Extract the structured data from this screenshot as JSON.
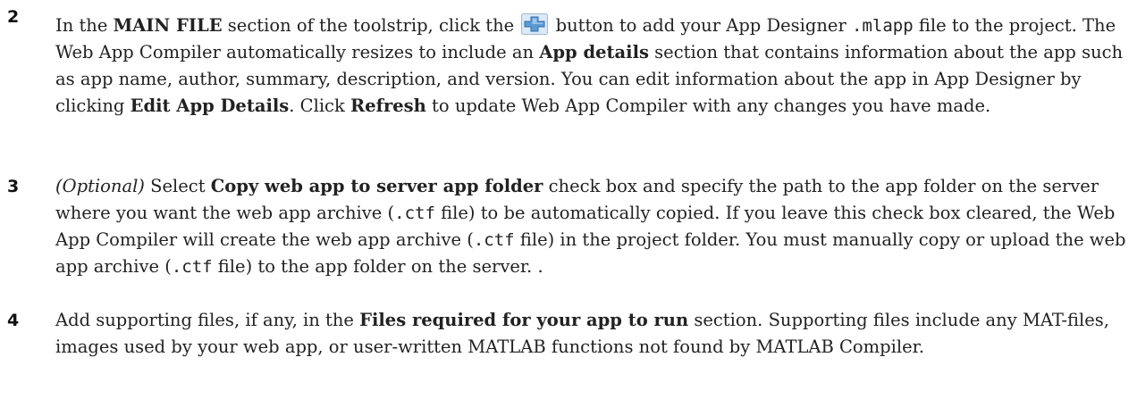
{
  "steps": [
    {
      "number": "2",
      "segments": [
        "In the ",
        "MAIN FILE",
        " section of the toolstrip, click the ",
        " button to add your App Designer ",
        ".mlapp",
        " file to the project. The Web App Compiler automatically resizes to include an ",
        "App details",
        " section that contains information about the app such as app name, author, summary, description, and version. You can edit information about the app in App Designer by clicking ",
        "Edit App Details",
        ". Click ",
        "Refresh",
        " to update Web App Compiler with any changes you have made."
      ],
      "icon": "add-file-plus-icon"
    },
    {
      "number": "3",
      "segments": [
        "(Optional)",
        " Select ",
        "Copy web app to server app folder",
        " check box and specify the path to the app folder on the server where you want the web app archive (",
        ".ctf",
        " file) to be automatically copied. If you leave this check box cleared, the Web App Compiler will create the web app archive (",
        ".ctf",
        " file) in the project folder. You must manually copy or upload the web app archive (",
        ".ctf",
        " file) to the app folder on the server. ."
      ]
    },
    {
      "number": "4",
      "segments": [
        "Add supporting files, if any, in the ",
        "Files required for your app to run",
        " section. Supporting files include any MAT-files, images used by your web app, or user-written MATLAB functions not found by MATLAB Compiler."
      ]
    }
  ],
  "colors": {
    "text": "#222222",
    "icon_blue": "#5b9bd5",
    "icon_frame": "#2f6fb0"
  }
}
